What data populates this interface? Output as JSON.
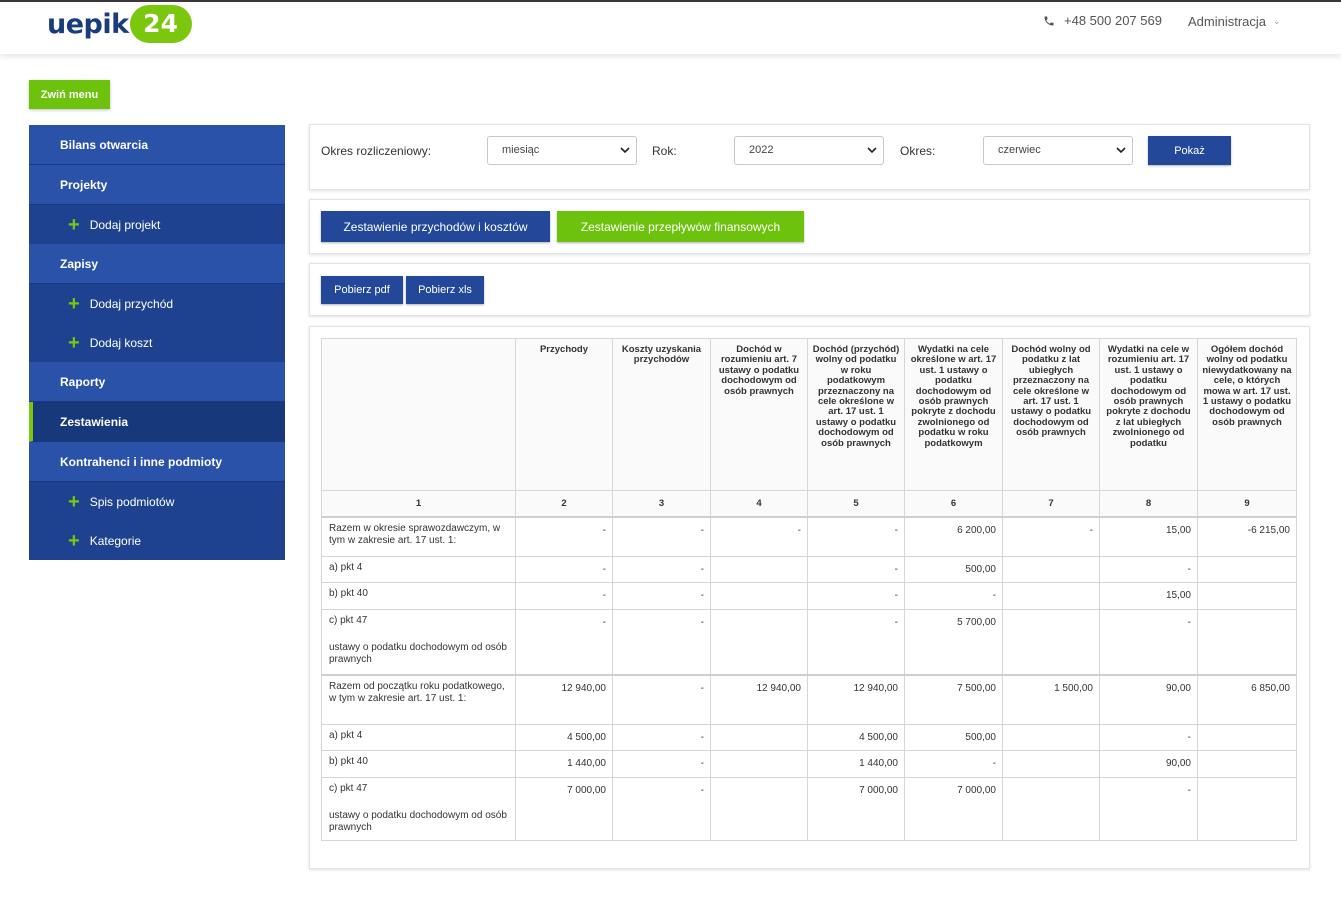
{
  "header": {
    "logo_text": "uepik",
    "logo_badge": "24",
    "phone": "+48 500 207 569",
    "admin_label": "Administracja",
    "colors": {
      "brand_blue": "#1f4596",
      "brand_green": "#7ac70e"
    }
  },
  "collapse_label": "Zwiń menu",
  "sidebar": {
    "items": [
      {
        "label": "Bilans otwarcia"
      },
      {
        "label": "Projekty"
      },
      {
        "label": "Dodaj projekt"
      },
      {
        "label": "Zapisy"
      },
      {
        "label": "Dodaj przychód"
      },
      {
        "label": "Dodaj koszt"
      },
      {
        "label": "Raporty"
      },
      {
        "label": "Zestawienia"
      },
      {
        "label": "Kontrahenci i inne podmioty"
      },
      {
        "label": "Spis podmiotów"
      },
      {
        "label": "Kategorie"
      }
    ]
  },
  "filters": {
    "period_type_label": "Okres rozliczeniowy:",
    "period_type_value": "miesiąc",
    "year_label": "Rok:",
    "year_value": "2022",
    "period_label": "Okres:",
    "period_value": "czerwiec",
    "show_label": "Pokaż"
  },
  "tabs": {
    "income_costs": "Zestawienie przychodów i kosztów",
    "cash_flows": "Zestawienie przepływów finansowych"
  },
  "downloads": {
    "pdf": "Pobierz pdf",
    "xls": "Pobierz xls"
  },
  "table": {
    "headers": [
      "",
      "Przychody",
      "Koszty uzyskania przychodów",
      "Dochód w rozumieniu art. 7 ustawy o podatku dochodowym od osób prawnych",
      "Dochód (przychód) wolny od podatku w roku podatkowym przeznaczony na cele określone w art. 17 ust. 1 ustawy o podatku dochodowym od osób prawnych",
      "Wydatki na cele określone w art. 17 ust. 1 ustawy o podatku dochodowym od osób prawnych pokryte z dochodu zwolnionego od podatku w roku podatkowym",
      "Dochód wolny od podatku z lat ubiegłych przeznaczony na cele określone w art. 17 ust. 1 ustawy o podatku dochodowym od osób prawnych",
      "Wydatki na cele w rozumieniu art. 17 ust. 1 ustawy o podatku dochodowym od osób prawnych pokryte z dochodu z lat ubiegłych zwolnionego od podatku",
      "Ogółem dochód wolny od podatku niewydatkowany na cele, o których mowa w art. 17 ust. 1 ustawy o podatku dochodowym od osób prawnych"
    ],
    "col_numbers": [
      "1",
      "2",
      "3",
      "4",
      "5",
      "6",
      "7",
      "8",
      "9"
    ],
    "section1": {
      "total_label": "Razem w okresie sprawozdawczym, w tym w zakresie art. 17 ust. 1:",
      "total": [
        "-",
        "-",
        "-",
        "-",
        "6 200,00",
        "-",
        "15,00",
        "-6 215,00"
      ],
      "a_label": "a) pkt 4",
      "a": [
        "-",
        "-",
        "",
        "-",
        "500,00",
        "",
        "-",
        ""
      ],
      "b_label": "b) pkt 40",
      "b": [
        "-",
        "-",
        "",
        "-",
        "-",
        "",
        "15,00",
        ""
      ],
      "c_label": "c) pkt 47",
      "c": [
        "-",
        "-",
        "",
        "-",
        "5 700,00",
        "",
        "-",
        ""
      ],
      "note": "ustawy o podatku dochodowym od osób prawnych"
    },
    "section2": {
      "total_label": "Razem od początku roku podatkowego, w tym w zakresie art. 17 ust. 1:",
      "total": [
        "12 940,00",
        "-",
        "12 940,00",
        "12 940,00",
        "7 500,00",
        "1 500,00",
        "90,00",
        "6 850,00"
      ],
      "a_label": "a) pkt 4",
      "a": [
        "4 500,00",
        "-",
        "",
        "4 500,00",
        "500,00",
        "",
        "-",
        ""
      ],
      "b_label": "b) pkt 40",
      "b": [
        "1 440,00",
        "-",
        "",
        "1 440,00",
        "-",
        "",
        "90,00",
        ""
      ],
      "c_label": "c) pkt 47",
      "c": [
        "7 000,00",
        "-",
        "",
        "7 000,00",
        "7 000,00",
        "",
        "-",
        ""
      ],
      "note": "ustawy o podatku dochodowym od osób prawnych"
    }
  }
}
